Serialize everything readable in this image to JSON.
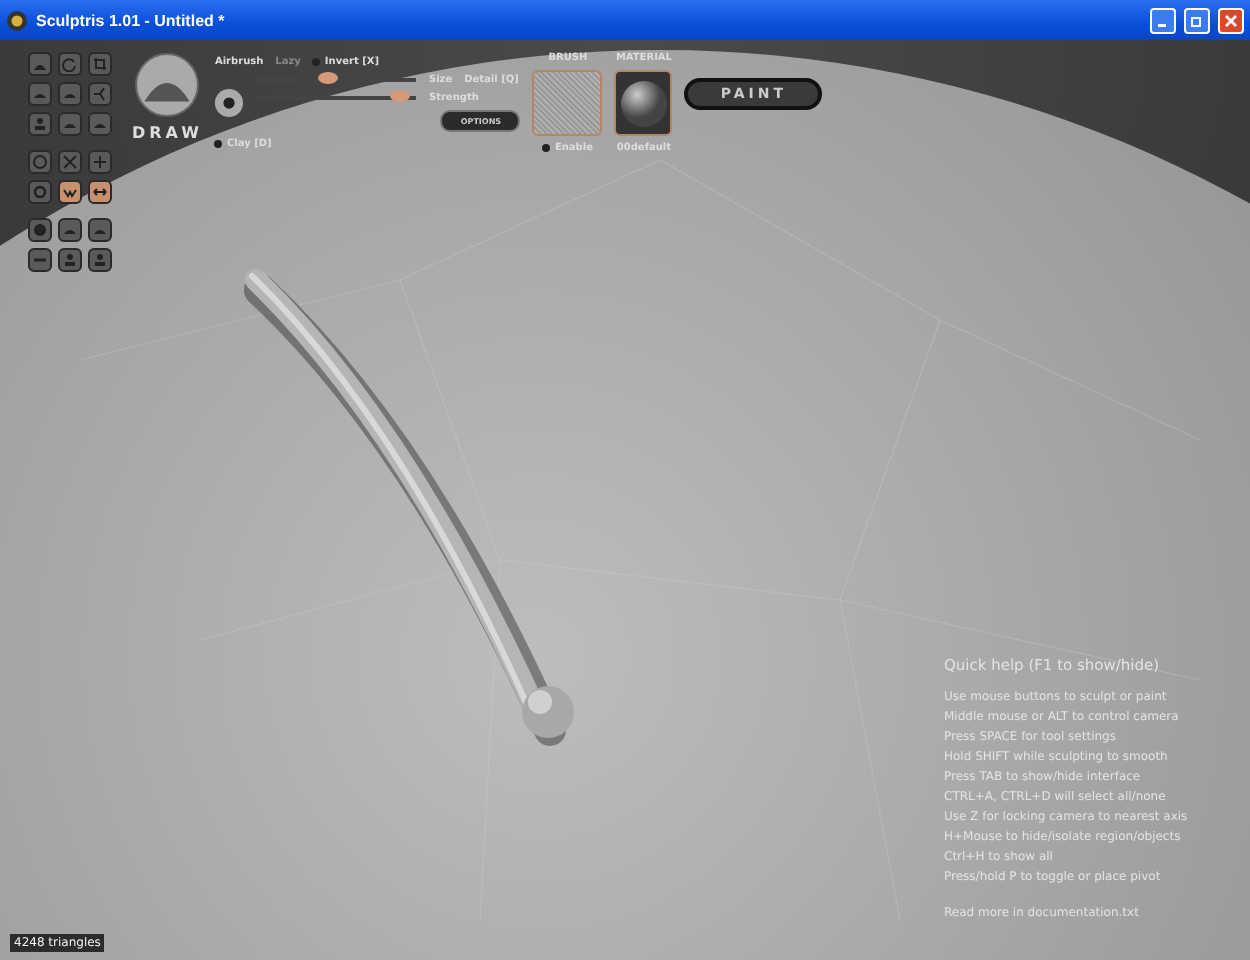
{
  "window": {
    "title": "Sculptris 1.01 - Untitled *"
  },
  "tool_groups": [
    {
      "tools": [
        {
          "kind": "dome",
          "selected": false
        },
        {
          "kind": "rotate",
          "selected": false
        },
        {
          "kind": "crop",
          "selected": false
        },
        {
          "kind": "flat",
          "selected": false
        },
        {
          "kind": "flat",
          "selected": false
        },
        {
          "kind": "fork",
          "selected": false
        },
        {
          "kind": "person",
          "selected": false
        },
        {
          "kind": "flat",
          "selected": false
        },
        {
          "kind": "flat",
          "selected": false
        }
      ]
    },
    {
      "tools": [
        {
          "kind": "circle",
          "selected": false
        },
        {
          "kind": "cross",
          "selected": false
        },
        {
          "kind": "grid",
          "selected": false
        },
        {
          "kind": "ring",
          "selected": false
        },
        {
          "kind": "wave",
          "selected": true
        },
        {
          "kind": "arrows",
          "selected": true
        }
      ]
    },
    {
      "tools": [
        {
          "kind": "ball",
          "selected": false
        },
        {
          "kind": "flat",
          "selected": false
        },
        {
          "kind": "flat",
          "selected": false
        },
        {
          "kind": "line",
          "selected": false
        },
        {
          "kind": "person",
          "selected": false
        },
        {
          "kind": "person",
          "selected": false
        }
      ]
    }
  ],
  "brush_panel": {
    "tool_name": "DRAW",
    "toggles": [
      {
        "label": "Airbrush",
        "on": true
      },
      {
        "label": "Lazy",
        "on": false
      },
      {
        "label": "Invert [X]",
        "on": false
      }
    ],
    "clay": {
      "label": "Clay [D]",
      "on": false
    },
    "sliders": [
      {
        "label": "Size",
        "level": 0.45
      },
      {
        "label": "Strength",
        "level": 0.9
      }
    ],
    "detail": "Detail [Q]",
    "options": "OPTIONS",
    "brush": {
      "heading": "BRUSH",
      "enable": {
        "label": "Enable",
        "on": false
      }
    },
    "material": {
      "heading": "MATERIAL",
      "name": "00default"
    },
    "paint": "PAINT"
  },
  "quick_help": {
    "title": "Quick help (F1 to show/hide)",
    "lines": [
      "Use mouse buttons to sculpt or paint",
      "Middle mouse or ALT to control camera",
      "Press SPACE for tool settings",
      "Hold SHIFT while sculpting to smooth",
      "Press TAB to show/hide interface",
      "CTRL+A, CTRL+D will select all/none",
      "Use Z for locking camera to nearest axis",
      "H+Mouse to hide/isolate region/objects",
      "Ctrl+H to show all",
      "Press/hold P to toggle or place pivot"
    ],
    "footer": "Read more in documentation.txt"
  },
  "status": "4248 triangles"
}
